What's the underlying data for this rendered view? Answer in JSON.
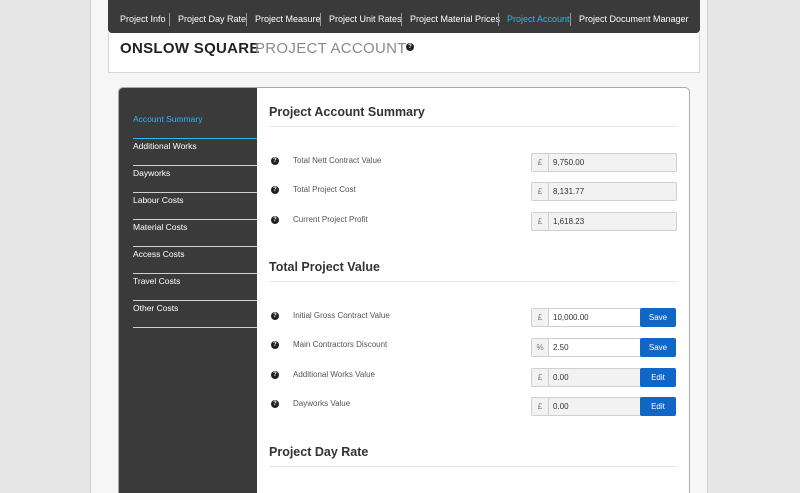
{
  "topnav": {
    "items": [
      {
        "label": "Project Info"
      },
      {
        "label": "Project Day Rate"
      },
      {
        "label": "Project Measure"
      },
      {
        "label": "Project Unit Rates"
      },
      {
        "label": "Project Material Prices"
      },
      {
        "label": "Project Account"
      },
      {
        "label": "Project Document Manager"
      }
    ],
    "active": "Project Account"
  },
  "header": {
    "title_bold": "ONSLOW SQUARE",
    "title_light": "PROJECT ACCOUNT",
    "help_glyph": "?"
  },
  "sidebar": {
    "items": [
      {
        "label": "Account Summary"
      },
      {
        "label": "Additional Works"
      },
      {
        "label": "Dayworks"
      },
      {
        "label": "Labour Costs"
      },
      {
        "label": "Material Costs"
      },
      {
        "label": "Access Costs"
      },
      {
        "label": "Travel Costs"
      },
      {
        "label": "Other Costs"
      }
    ],
    "active": "Account Summary"
  },
  "summary": {
    "title": "Project Account Summary",
    "rows": [
      {
        "label": "Total Nett Contract Value",
        "prefix": "£",
        "value": "9,750.00"
      },
      {
        "label": "Total Project Cost",
        "prefix": "£",
        "value": "8,131.77"
      },
      {
        "label": "Current Project Profit",
        "prefix": "£",
        "value": "1,618.23"
      }
    ]
  },
  "total_value": {
    "title": "Total Project Value",
    "rows": [
      {
        "label": "Initial Gross Contract Value",
        "prefix": "£",
        "value": "10,000.00",
        "button": "Save"
      },
      {
        "label": "Main Contractors Discount",
        "prefix": "%",
        "value": "2.50",
        "button": "Save"
      },
      {
        "label": "Additional Works Value",
        "prefix": "£",
        "value": "0.00",
        "button": "Edit"
      },
      {
        "label": "Dayworks Value",
        "prefix": "£",
        "value": "0.00",
        "button": "Edit"
      }
    ]
  },
  "day_rate": {
    "title": "Project Day Rate"
  },
  "colors": {
    "nav_bg": "#3a3a3a",
    "accent": "#29b6f6",
    "button": "#1067c7"
  }
}
